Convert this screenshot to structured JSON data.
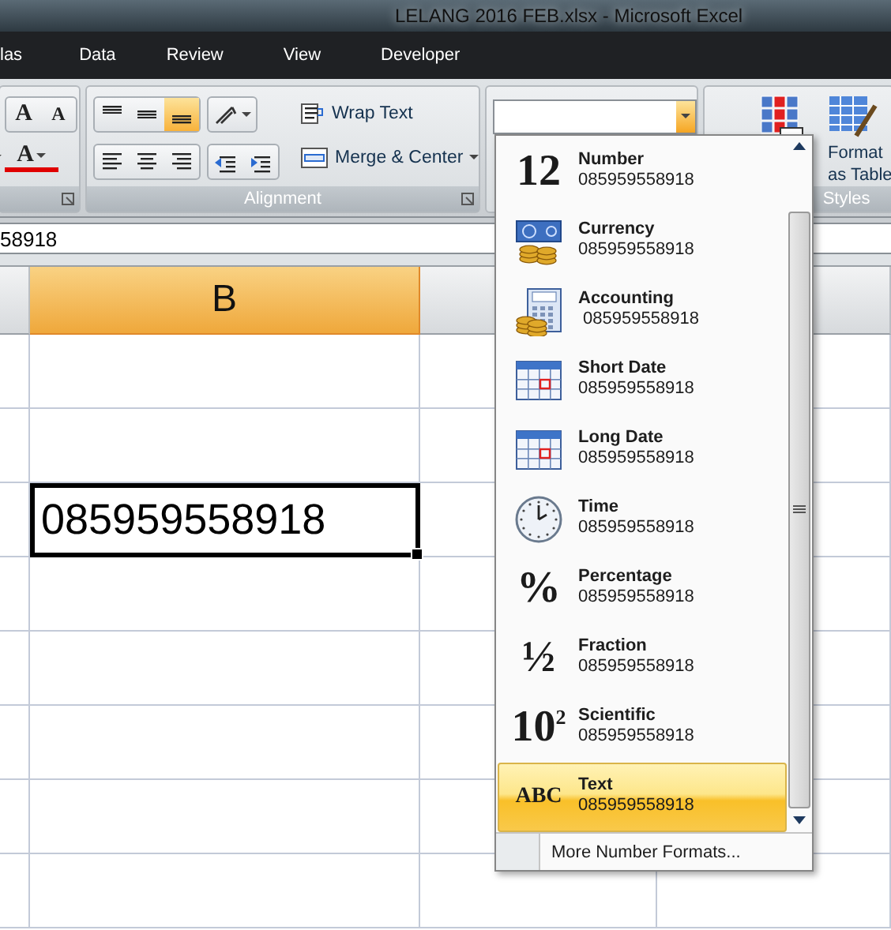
{
  "window": {
    "title": "LELANG 2016 FEB.xlsx - Microsoft Excel"
  },
  "tabs": [
    {
      "label": "las",
      "selected": false
    },
    {
      "label": "Data",
      "selected": false
    },
    {
      "label": "Review",
      "selected": false
    },
    {
      "label": "View",
      "selected": false
    },
    {
      "label": "Developer",
      "selected": false
    }
  ],
  "ribbon": {
    "font_group": {
      "grow_font": "A",
      "shrink_font": "A",
      "font_color": "A"
    },
    "alignment_group": {
      "label": "Alignment",
      "vertical_align": [
        {
          "selected": false
        },
        {
          "selected": false
        },
        {
          "selected": true
        }
      ],
      "wrap_text": "Wrap Text",
      "merge_center": "Merge & Center"
    },
    "styles_group": {
      "label": "Styles",
      "format_as_table": [
        "Format",
        "as Table"
      ]
    }
  },
  "formula_bar": {
    "value": "58918"
  },
  "sheet": {
    "column_header": {
      "label": "B",
      "selected": true
    },
    "active_cell": {
      "value": "085959558918"
    }
  },
  "format_menu": {
    "items": [
      {
        "kind": "glyph",
        "glyph": "12",
        "label": "Number",
        "value": "085959558918",
        "selected": false
      },
      {
        "kind": "currency",
        "label": "Currency",
        "value": "085959558918",
        "selected": false
      },
      {
        "kind": "accounting",
        "label": "Accounting",
        "value": " 085959558918",
        "selected": false
      },
      {
        "kind": "calendar",
        "label": "Short Date",
        "value": "085959558918",
        "selected": false
      },
      {
        "kind": "calendar",
        "label": "Long Date",
        "value": "085959558918",
        "selected": false
      },
      {
        "kind": "clock",
        "label": "Time",
        "value": "085959558918",
        "selected": false
      },
      {
        "kind": "glyph",
        "glyph": "%",
        "label": "Percentage",
        "value": "085959558918",
        "selected": false
      },
      {
        "kind": "glyph",
        "glyph": "½",
        "label": "Fraction",
        "value": "085959558918",
        "selected": false
      },
      {
        "kind": "glyph",
        "glyph": "10$^{2}$",
        "label": "Scientific",
        "value": "085959558918",
        "selected": false
      },
      {
        "kind": "glyph",
        "glyph": "ABC",
        "label": "Text",
        "value": "085959558918",
        "selected": true
      }
    ],
    "more": "More Number Formats..."
  }
}
